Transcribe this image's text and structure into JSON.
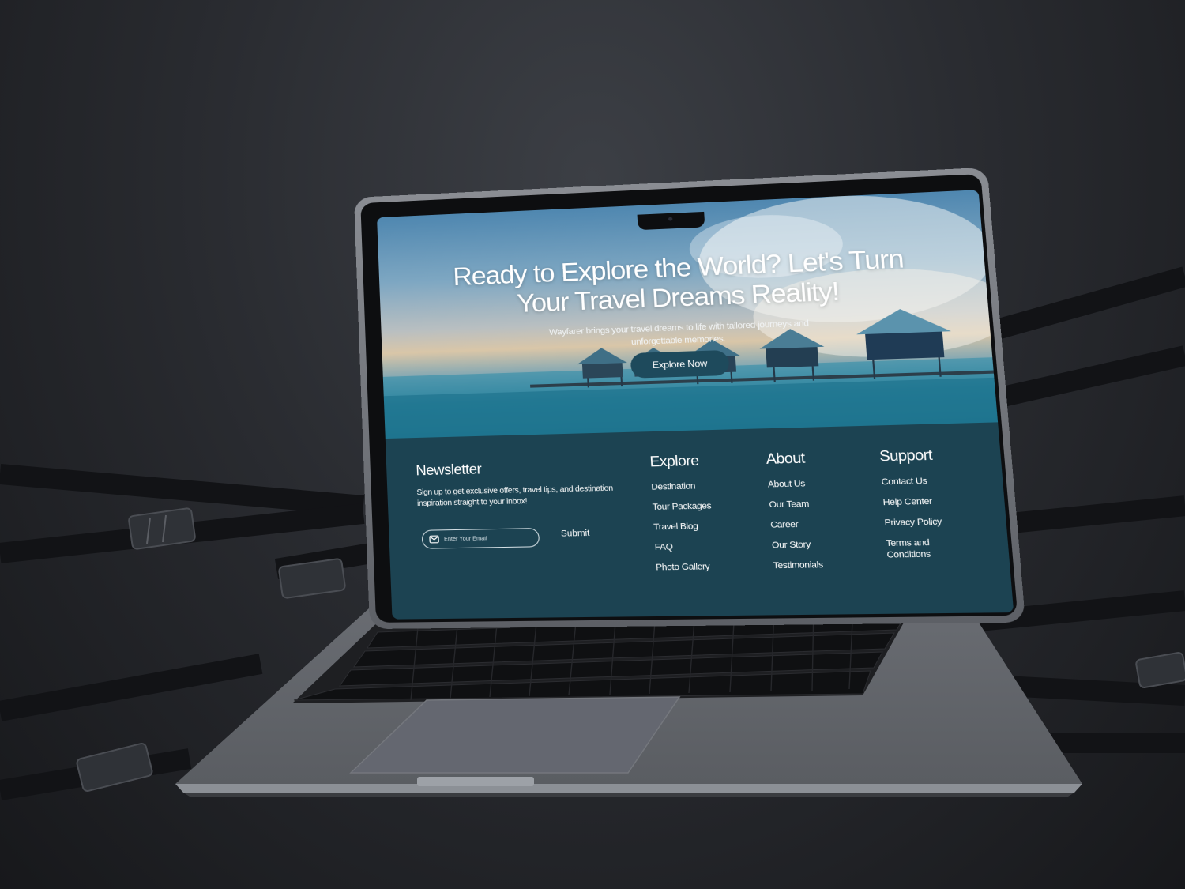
{
  "hero": {
    "title": "Ready to Explore the World? Let's Turn Your Travel Dreams Reality!",
    "subtitle": "Wayfarer brings your travel dreams to life with tailored journeys and unforgettable memories.",
    "cta_label": "Explore Now"
  },
  "newsletter": {
    "title": "Newsletter",
    "text": "Sign up to get exclusive offers, travel tips, and destination inspiration straight to your inbox!",
    "email_placeholder": "Enter Your Email",
    "submit_label": "Submit"
  },
  "footer": {
    "explore": {
      "title": "Explore",
      "links": [
        "Destination",
        "Tour Packages",
        "Travel Blog",
        "FAQ",
        "Photo Gallery"
      ]
    },
    "about": {
      "title": "About",
      "links": [
        "About Us",
        "Our Team",
        "Career",
        "Our Story",
        "Testimonials"
      ]
    },
    "support": {
      "title": "Support",
      "links": [
        "Contact Us",
        "Help Center",
        "Privacy Policy",
        "Terms and Conditions"
      ]
    }
  },
  "colors": {
    "footer_bg": "#1c4352",
    "cta_bg": "#1e4a5c",
    "laptop_body": "#5f6267",
    "background": "#2a2c31"
  },
  "icons": {
    "email": "mail-icon"
  }
}
